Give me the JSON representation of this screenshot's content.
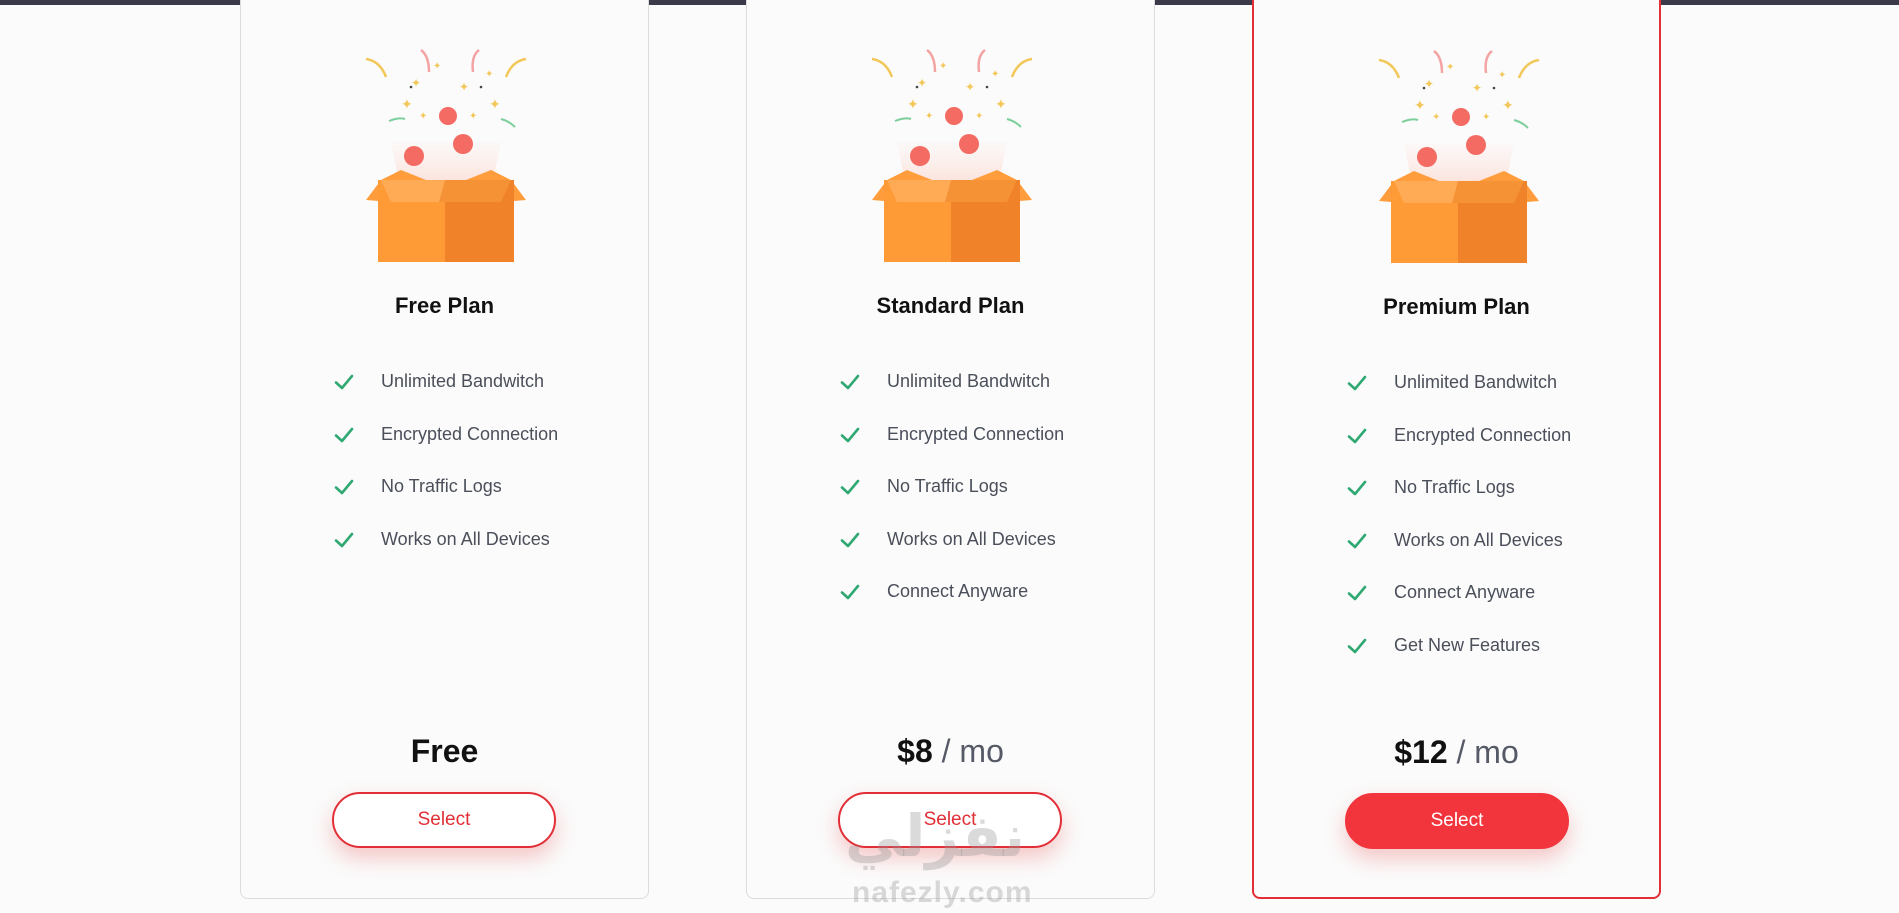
{
  "plans": [
    {
      "title": "Free Plan",
      "features": [
        "Unlimited Bandwitch",
        "Encrypted Connection",
        "No Traffic Logs",
        "Works on All Devices"
      ],
      "price": "Free",
      "period": "",
      "button": "Select",
      "featured": false
    },
    {
      "title": "Standard Plan",
      "features": [
        "Unlimited Bandwitch",
        "Encrypted Connection",
        "No Traffic Logs",
        "Works on All Devices",
        "Connect Anyware"
      ],
      "price": "$8",
      "period": "/ mo",
      "button": "Select",
      "featured": false
    },
    {
      "title": "Premium Plan",
      "features": [
        "Unlimited Bandwitch",
        "Encrypted Connection",
        "No Traffic Logs",
        "Works on All Devices",
        "Connect Anyware",
        "Get New Features"
      ],
      "price": "$12",
      "period": "/ mo",
      "button": "Select",
      "featured": true
    }
  ],
  "icons": {
    "illustration": "gift-box-icon",
    "feature": "check-icon"
  },
  "colors": {
    "accent": "#f2353c",
    "check": "#2fa872",
    "box": "#ff8a2a"
  },
  "watermark": {
    "arabic": "نفزلي",
    "latin": "nafezly.com"
  }
}
